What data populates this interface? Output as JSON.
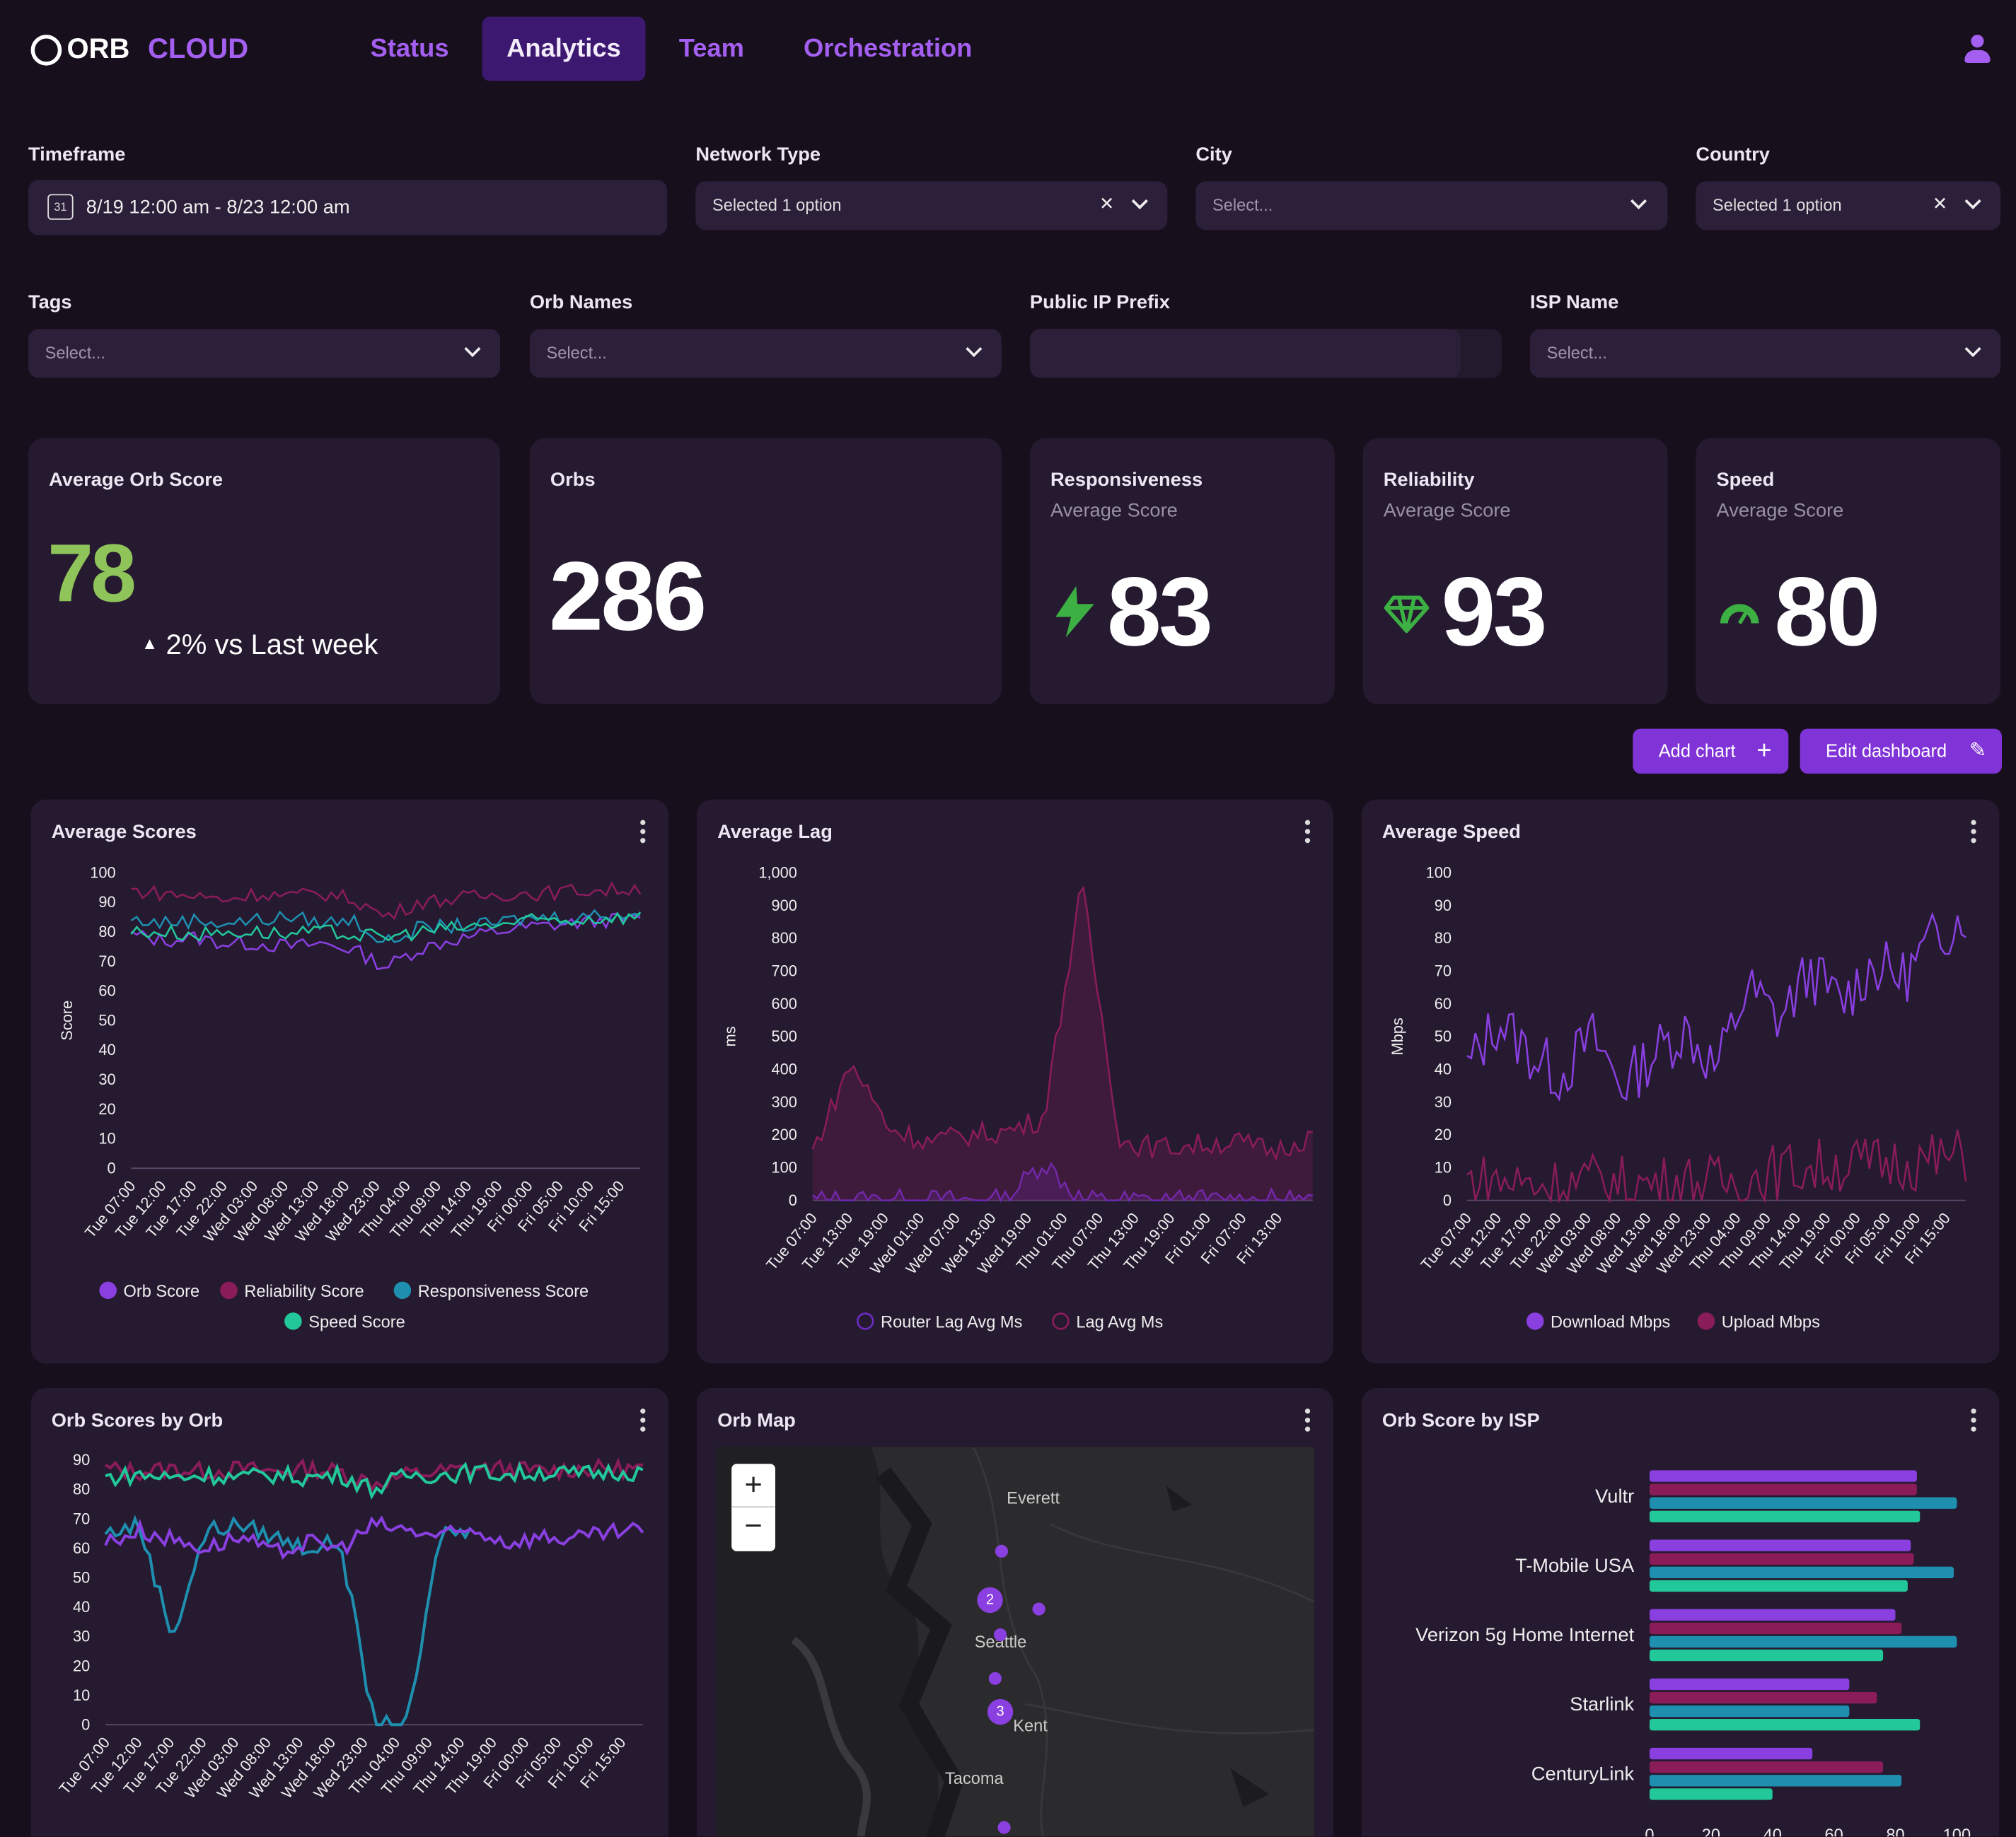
{
  "brand": {
    "name": "ORB",
    "suffix": "CLOUD"
  },
  "nav": {
    "items": [
      "Status",
      "Analytics",
      "Team",
      "Orchestration"
    ],
    "active": "Analytics"
  },
  "filters": {
    "timeframe": {
      "label": "Timeframe",
      "value": "8/19 12:00 am - 8/23 12:00 am",
      "icon": "calendar-icon",
      "icon_text": "31"
    },
    "network_type": {
      "label": "Network Type",
      "value": "Selected 1 option"
    },
    "city": {
      "label": "City",
      "placeholder": "Select..."
    },
    "country": {
      "label": "Country",
      "value": "Selected 1 option"
    },
    "tags": {
      "label": "Tags",
      "placeholder": "Select..."
    },
    "orb_names": {
      "label": "Orb Names",
      "placeholder": "Select..."
    },
    "public_ip_prefix": {
      "label": "Public IP Prefix",
      "value": ""
    },
    "isp_name": {
      "label": "ISP Name",
      "placeholder": "Select..."
    }
  },
  "kpis": {
    "avg_orb_score": {
      "title": "Average Orb Score",
      "value": "78",
      "delta": "2% vs Last week",
      "color": "#8fc45a"
    },
    "orbs": {
      "title": "Orbs",
      "value": "286"
    },
    "responsiveness": {
      "title": "Responsiveness",
      "subtitle": "Average Score",
      "value": "83",
      "icon": "lightning-icon"
    },
    "reliability": {
      "title": "Reliability",
      "subtitle": "Average Score",
      "value": "93",
      "icon": "diamond-icon"
    },
    "speed": {
      "title": "Speed",
      "subtitle": "Average Score",
      "value": "80",
      "icon": "speedometer-icon"
    }
  },
  "actions": {
    "add_chart": "Add chart",
    "edit_dashboard": "Edit dashboard"
  },
  "colors": {
    "purple": "#8a3fe0",
    "crimson": "#8a1c5a",
    "teal": "#1f8fb0",
    "green": "#22c79a",
    "accent": "#8033d6"
  },
  "chart_data": [
    {
      "type": "line",
      "title": "Average Scores",
      "ylabel": "Score",
      "ylim": [
        0,
        100
      ],
      "x": [
        "Tue 07:00",
        "Tue 12:00",
        "Tue 17:00",
        "Tue 22:00",
        "Wed 03:00",
        "Wed 08:00",
        "Wed 13:00",
        "Wed 18:00",
        "Wed 23:00",
        "Thu 04:00",
        "Thu 09:00",
        "Thu 14:00",
        "Thu 19:00",
        "Fri 00:00",
        "Fri 05:00",
        "Fri 10:00",
        "Fri 15:00"
      ],
      "yticks": [
        "0",
        "10",
        "20",
        "30",
        "40",
        "50",
        "60",
        "70",
        "80",
        "90",
        "100"
      ],
      "series": [
        {
          "name": "Orb Score",
          "color": "#8a3fe0",
          "values": [
            79,
            77,
            78,
            76,
            76,
            75,
            76,
            74,
            68,
            74,
            77,
            79,
            81,
            82,
            83,
            84,
            84
          ]
        },
        {
          "name": "Reliability Score",
          "color": "#8a1c5a",
          "values": [
            94,
            93,
            92,
            91,
            93,
            92,
            93,
            91,
            85,
            90,
            91,
            92,
            93,
            93,
            94,
            94,
            95
          ]
        },
        {
          "name": "Responsiveness Score",
          "color": "#1f8fb0",
          "values": [
            84,
            83,
            84,
            83,
            84,
            85,
            83,
            84,
            76,
            81,
            82,
            82,
            84,
            85,
            85,
            86,
            86
          ]
        },
        {
          "name": "Speed Score",
          "color": "#22c79a",
          "values": [
            80,
            80,
            79,
            80,
            80,
            79,
            80,
            79,
            78,
            80,
            81,
            82,
            83,
            84,
            84,
            85,
            85
          ]
        }
      ]
    },
    {
      "type": "area",
      "title": "Average Lag",
      "ylabel": "ms",
      "ylim": [
        0,
        1000
      ],
      "x": [
        "Tue 07:00",
        "Tue 13:00",
        "Tue 19:00",
        "Wed 01:00",
        "Wed 07:00",
        "Wed 13:00",
        "Wed 19:00",
        "Thu 01:00",
        "Thu 07:00",
        "Thu 13:00",
        "Thu 19:00",
        "Fri 01:00",
        "Fri 07:00",
        "Fri 13:00"
      ],
      "yticks": [
        "0",
        "100",
        "200",
        "300",
        "400",
        "500",
        "600",
        "700",
        "800",
        "900",
        "1,000"
      ],
      "series": [
        {
          "name": "Router Lag Avg Ms",
          "color": "#6a2cc0",
          "values": [
            0,
            0,
            0,
            0,
            0,
            0,
            120,
            0,
            0,
            0,
            0,
            0,
            0,
            0
          ]
        },
        {
          "name": "Lag Avg Ms",
          "color": "#8a1c5a",
          "values": [
            150,
            420,
            220,
            180,
            200,
            210,
            250,
            960,
            180,
            160,
            170,
            180,
            150,
            200
          ]
        }
      ]
    },
    {
      "type": "line",
      "title": "Average Speed",
      "ylabel": "Mbps",
      "ylim": [
        0,
        100
      ],
      "x": [
        "Tue 07:00",
        "Tue 12:00",
        "Tue 17:00",
        "Tue 22:00",
        "Wed 03:00",
        "Wed 08:00",
        "Wed 13:00",
        "Wed 18:00",
        "Wed 23:00",
        "Thu 04:00",
        "Thu 09:00",
        "Thu 14:00",
        "Thu 19:00",
        "Fri 00:00",
        "Fri 05:00",
        "Fri 10:00",
        "Fri 15:00"
      ],
      "yticks": [
        "0",
        "10",
        "20",
        "30",
        "40",
        "50",
        "60",
        "70",
        "80",
        "90",
        "100"
      ],
      "series": [
        {
          "name": "Download Mbps",
          "color": "#8a3fe0",
          "values": [
            40,
            55,
            45,
            38,
            50,
            35,
            45,
            52,
            40,
            65,
            55,
            70,
            60,
            72,
            68,
            80,
            88
          ]
        },
        {
          "name": "Upload Mbps",
          "color": "#8a1c5a",
          "values": [
            6,
            6,
            5,
            5,
            6,
            5,
            5,
            6,
            5,
            7,
            9,
            10,
            11,
            11,
            12,
            12,
            14
          ]
        }
      ]
    },
    {
      "type": "line",
      "title": "Orb Scores by Orb",
      "ylim": [
        0,
        90
      ],
      "x": [
        "Tue 07:00",
        "Tue 12:00",
        "Tue 17:00",
        "Tue 22:00",
        "Wed 03:00",
        "Wed 08:00",
        "Wed 13:00",
        "Wed 18:00",
        "Wed 23:00",
        "Thu 04:00",
        "Thu 09:00",
        "Thu 14:00",
        "Thu 19:00",
        "Fri 00:00",
        "Fri 05:00",
        "Fri 10:00",
        "Fri 15:00"
      ],
      "yticks": [
        "0",
        "10",
        "20",
        "30",
        "40",
        "50",
        "60",
        "70",
        "80",
        "90"
      ],
      "series": [
        {
          "color": "#8a1c5a",
          "values": [
            87,
            86,
            87,
            86,
            87,
            86,
            87,
            86,
            82,
            85,
            86,
            87,
            87,
            86,
            87,
            87,
            87
          ]
        },
        {
          "color": "#22c79a",
          "values": [
            84,
            85,
            84,
            85,
            84,
            85,
            84,
            85,
            80,
            85,
            85,
            86,
            85,
            86,
            85,
            86,
            86
          ]
        },
        {
          "color": "#1f8fb0",
          "values": [
            65,
            68,
            30,
            66,
            68,
            64,
            60,
            62,
            0,
            0,
            66,
            65,
            null,
            null,
            null,
            null,
            null
          ]
        },
        {
          "color": "#8a3fe0",
          "values": [
            62,
            66,
            63,
            60,
            64,
            58,
            62,
            60,
            68,
            66,
            64,
            66,
            62,
            64,
            63,
            65,
            66
          ]
        }
      ]
    },
    {
      "type": "bar",
      "title": "Orb Score by ISP",
      "orientation": "horizontal",
      "categories": [
        "Vultr",
        "T-Mobile USA",
        "Verizon 5g Home Internet",
        "Starlink",
        "CenturyLink"
      ],
      "xticks": [
        "0",
        "20",
        "40",
        "60",
        "80",
        "100"
      ],
      "series": [
        {
          "color": "#8a3fe0",
          "values": [
            87,
            85,
            80,
            65,
            53
          ]
        },
        {
          "color": "#8a1c5a",
          "values": [
            87,
            86,
            82,
            74,
            76
          ]
        },
        {
          "color": "#1f8fb0",
          "values": [
            100,
            99,
            100,
            65,
            82
          ]
        },
        {
          "color": "#22c79a",
          "values": [
            88,
            84,
            76,
            88,
            40
          ]
        }
      ]
    }
  ],
  "map": {
    "title": "Orb Map",
    "zoom_in": "+",
    "zoom_out": "−",
    "places": [
      "Everett",
      "Seattle",
      "Kent",
      "Tacoma"
    ],
    "clusters": [
      "2",
      "3"
    ]
  }
}
